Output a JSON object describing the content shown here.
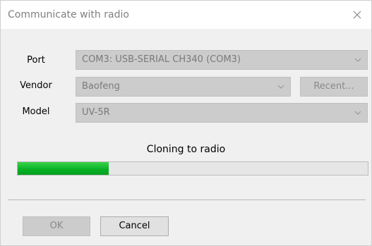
{
  "window": {
    "title": "Communicate with radio"
  },
  "form": {
    "port": {
      "label": "Port",
      "value": "COM3: USB-SERIAL CH340 (COM3)"
    },
    "vendor": {
      "label": "Vendor",
      "value": "Baofeng",
      "recent_label": "Recent..."
    },
    "model": {
      "label": "Model",
      "value": "UV-5R"
    }
  },
  "progress": {
    "status": "Cloning to radio",
    "fraction": 0.26,
    "color": "#06b025"
  },
  "buttons": {
    "ok_label": "OK",
    "cancel_label": "Cancel"
  },
  "icons": {
    "close": "close-icon",
    "dropdown": "chevron-down-icon"
  }
}
